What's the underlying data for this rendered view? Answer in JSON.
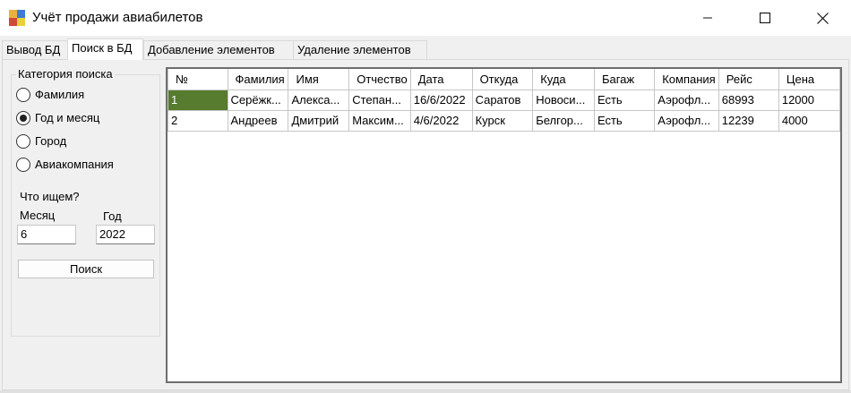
{
  "window": {
    "title": "Учёт продажи авиабилетов",
    "controls": [
      "minimize-icon",
      "maximize-icon",
      "close-icon"
    ]
  },
  "tabs": [
    {
      "label": "Вывод БД",
      "active": false
    },
    {
      "label": "Поиск в БД",
      "active": true
    },
    {
      "label": "Добавление элементов",
      "active": false
    },
    {
      "label": "Удаление элементов",
      "active": false
    }
  ],
  "search": {
    "category_title": "Категория поиска",
    "options": [
      {
        "label": "Фамилия",
        "checked": false
      },
      {
        "label": "Год и месяц",
        "checked": true
      },
      {
        "label": "Город",
        "checked": false
      },
      {
        "label": "Авиакомпания",
        "checked": false
      }
    ],
    "query_title": "Что ищем?",
    "month_label": "Месяц",
    "year_label": "Год",
    "month_value": "6",
    "year_value": "2022",
    "button_label": "Поиск"
  },
  "table": {
    "columns": [
      "№",
      "Фамилия",
      "Имя",
      "Отчество",
      "Дата",
      "Откуда",
      "Куда",
      "Багаж",
      "Компания",
      "Рейс",
      "Цена"
    ],
    "rows": [
      [
        "1",
        "Серёжк...",
        "Алекса...",
        "Степан...",
        "16/6/2022",
        "Саратов",
        "Новоси...",
        "Есть",
        "Аэрофл...",
        "68993",
        "12000"
      ],
      [
        "2",
        "Андреев",
        "Дмитрий",
        "Максим...",
        "4/6/2022",
        "Курск",
        "Белгор...",
        "Есть",
        "Аэрофл...",
        "12239",
        "4000"
      ]
    ],
    "selected_cell_color": "#577b2f"
  },
  "colors": {
    "window_bg": "#f0f0f0",
    "titlebar_bg": "#ffffff",
    "grid_border": "#6e6e6e",
    "selection": "#577b2f"
  }
}
